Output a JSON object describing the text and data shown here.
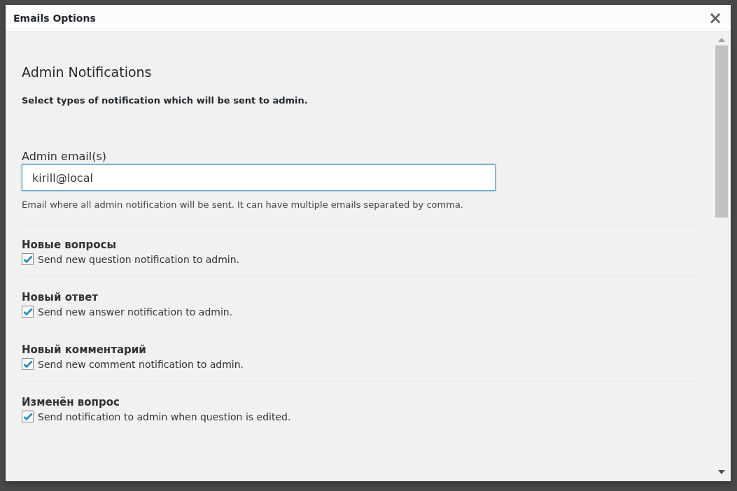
{
  "window": {
    "title": "Emails Options",
    "close": "×"
  },
  "section": {
    "title": "Admin Notifications",
    "subtitle": "Select types of notification which will be sent to admin."
  },
  "email_field": {
    "label": "Admin email(s)",
    "value": "kirill@local",
    "help": "Email where all admin notification will be sent. It can have multiple emails separated by comma."
  },
  "options": [
    {
      "title": "Новые вопросы",
      "label": "Send new question notification to admin.",
      "checked": true
    },
    {
      "title": "Новый ответ",
      "label": "Send new answer notification to admin.",
      "checked": true
    },
    {
      "title": "Новый комментарий",
      "label": "Send new comment notification to admin.",
      "checked": true
    },
    {
      "title": "Изменён вопрос",
      "label": "Send notification to admin when question is edited.",
      "checked": true
    }
  ]
}
